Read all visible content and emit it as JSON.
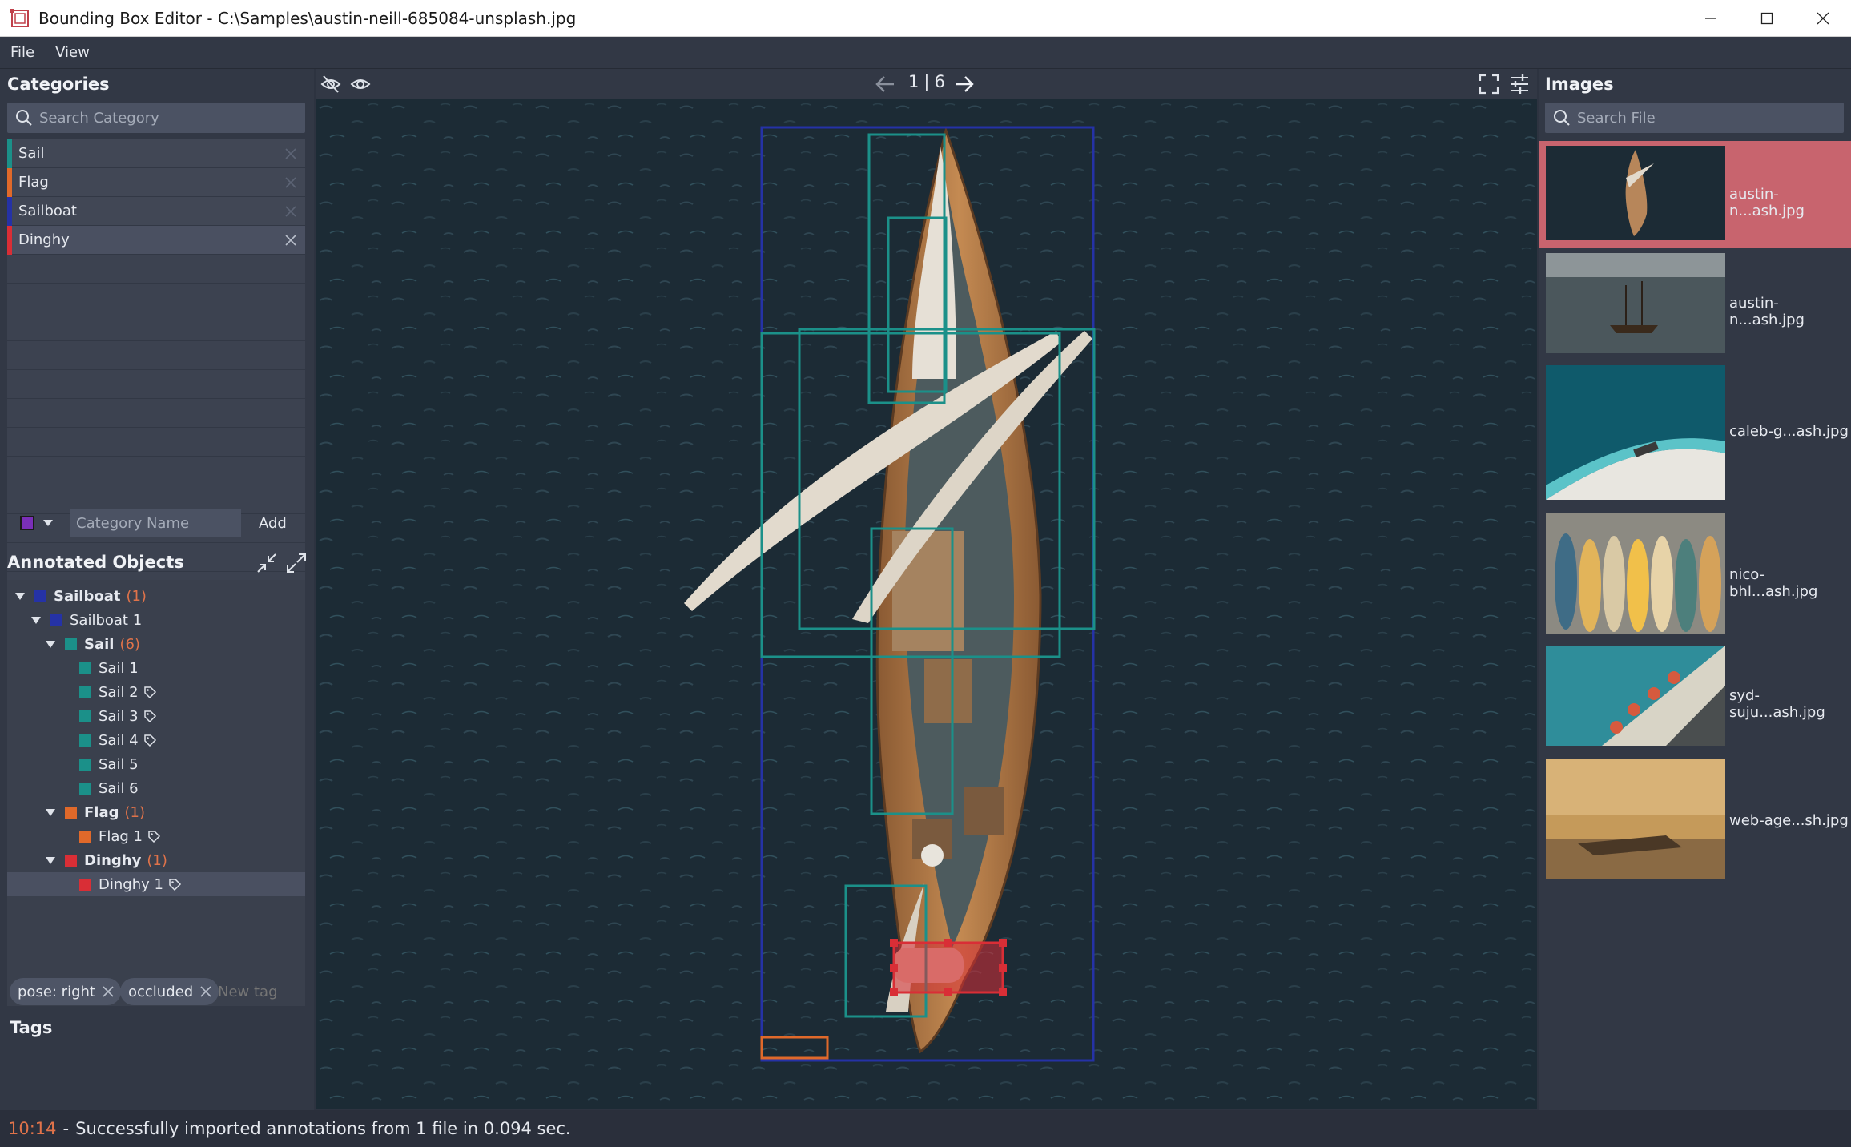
{
  "window": {
    "title": "Bounding Box Editor - C:\\Samples\\austin-neill-685084-unsplash.jpg"
  },
  "menu": [
    "File",
    "View"
  ],
  "categories": {
    "title": "Categories",
    "search_placeholder": "Search Category",
    "items": [
      {
        "label": "Sail",
        "color": "#1b9089"
      },
      {
        "label": "Flag",
        "color": "#e0692a"
      },
      {
        "label": "Sailboat",
        "color": "#2532a6"
      },
      {
        "label": "Dinghy",
        "color": "#d92e36"
      }
    ],
    "name_placeholder": "Category Name",
    "add_label": "Add",
    "new_color": "#7a2fb8"
  },
  "annotated": {
    "title": "Annotated Objects",
    "rows": [
      {
        "label": "Sailboat",
        "count": "(1)",
        "bold": true,
        "color": "#2532a6",
        "indent": 0,
        "expander": true
      },
      {
        "label": "Sailboat 1",
        "count": "",
        "bold": false,
        "color": "#2532a6",
        "indent": 1,
        "expander": true
      },
      {
        "label": "Sail",
        "count": "(6)",
        "bold": true,
        "color": "#1b9089",
        "indent": 2,
        "expander": true
      },
      {
        "label": "Sail 1",
        "count": "",
        "bold": false,
        "color": "#1b9089",
        "indent": 3,
        "expander": false,
        "tag": false
      },
      {
        "label": "Sail 2",
        "count": "",
        "bold": false,
        "color": "#1b9089",
        "indent": 3,
        "expander": false,
        "tag": true
      },
      {
        "label": "Sail 3",
        "count": "",
        "bold": false,
        "color": "#1b9089",
        "indent": 3,
        "expander": false,
        "tag": true
      },
      {
        "label": "Sail 4",
        "count": "",
        "bold": false,
        "color": "#1b9089",
        "indent": 3,
        "expander": false,
        "tag": true
      },
      {
        "label": "Sail 5",
        "count": "",
        "bold": false,
        "color": "#1b9089",
        "indent": 3,
        "expander": false,
        "tag": false
      },
      {
        "label": "Sail 6",
        "count": "",
        "bold": false,
        "color": "#1b9089",
        "indent": 3,
        "expander": false,
        "tag": false
      },
      {
        "label": "Flag",
        "count": "(1)",
        "bold": true,
        "color": "#e0692a",
        "indent": 2,
        "expander": true
      },
      {
        "label": "Flag 1",
        "count": "",
        "bold": false,
        "color": "#e0692a",
        "indent": 3,
        "expander": false,
        "tag": true
      },
      {
        "label": "Dinghy",
        "count": "(1)",
        "bold": true,
        "color": "#d92e36",
        "indent": 2,
        "expander": true
      },
      {
        "label": "Dinghy 1",
        "count": "",
        "bold": false,
        "color": "#d92e36",
        "indent": 3,
        "expander": false,
        "tag": true,
        "selected": true
      }
    ]
  },
  "tags": {
    "title": "Tags",
    "chips": [
      "pose: right",
      "occluded"
    ],
    "new_placeholder": "New tag"
  },
  "navigator": {
    "index": "1",
    "separator": "|",
    "total": "6"
  },
  "images": {
    "title": "Images",
    "search_placeholder": "Search File",
    "files": [
      {
        "name": "austin-n...ash.jpg"
      },
      {
        "name": "austin-n...ash.jpg"
      },
      {
        "name": "caleb-g...ash.jpg"
      },
      {
        "name": "nico-bhl...ash.jpg"
      },
      {
        "name": "syd-suju...ash.jpg"
      },
      {
        "name": "web-age...sh.jpg"
      }
    ]
  },
  "status": {
    "time": "10:14",
    "separator": "-",
    "message": "Successfully imported annotations from 1 file in 0.094 sec."
  }
}
